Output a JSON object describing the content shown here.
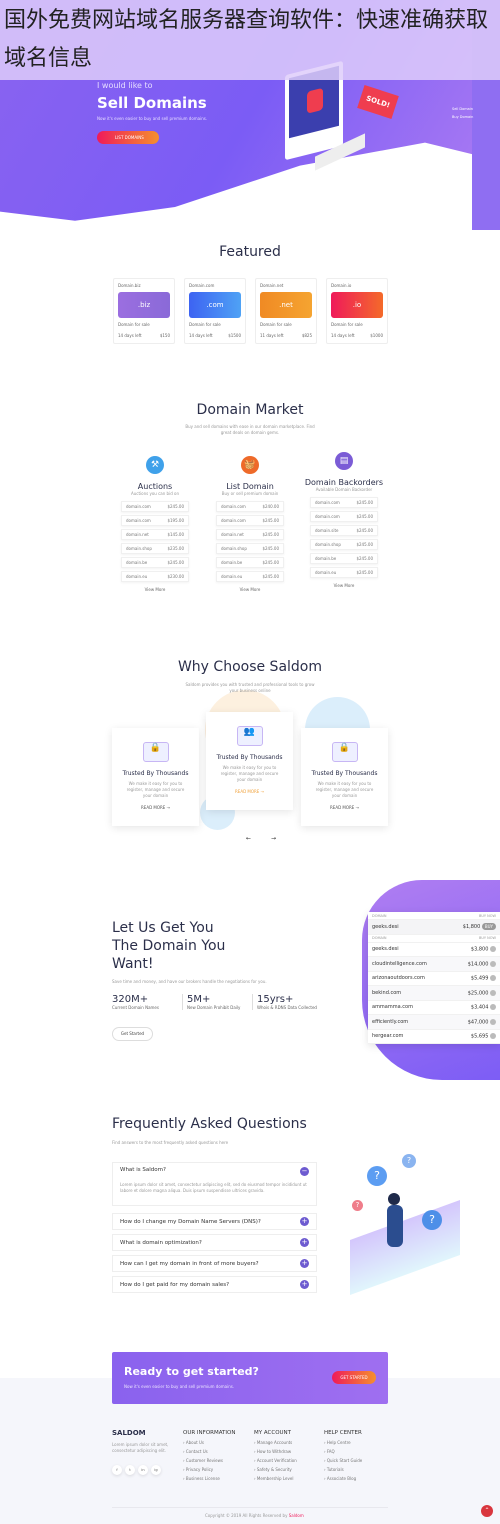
{
  "overlay_title": "国外免费网站域名服务器查询软件：快速准确获取域名信息",
  "hero": {
    "kicker": "I would like to",
    "title": "Sell Domains",
    "subtitle": "Now it's even easier to buy and sell premium domains.",
    "button": "LIST DOMAINS",
    "sign": "SOLD!",
    "toggle": [
      "Sell Domain",
      "Buy Domain"
    ]
  },
  "featured": {
    "title": "Featured",
    "cards": [
      {
        "name": "Domain.biz",
        "ext": ".biz",
        "status": "Domain for sale",
        "left": "14 days left",
        "price": "$150",
        "color1": "#9b6ee0",
        "color2": "#8a6ad8"
      },
      {
        "name": "Domain.com",
        "ext": ".com",
        "status": "Domain for sale",
        "left": "14 days left",
        "price": "$1500",
        "color1": "#3d63f2",
        "color2": "#4fa2f5"
      },
      {
        "name": "Domain.net",
        "ext": ".net",
        "status": "Domain for sale",
        "left": "11 days left",
        "price": "$825",
        "color1": "#f08a24",
        "color2": "#f5a431"
      },
      {
        "name": "Domain.io",
        "ext": ".io",
        "status": "Domain for sale",
        "left": "14 days left",
        "price": "$1000",
        "color1": "#ef1a5a",
        "color2": "#f46a2a"
      }
    ]
  },
  "market": {
    "title": "Domain Market",
    "subtitle": "Buy and sell domains with ease in our domain marketplace. Find great deals on domain gems.",
    "columns": [
      {
        "title": "Auctions",
        "subtitle": "Auctions you can bid on",
        "icon": "gavel-icon",
        "color": "#3fa1ea",
        "rows": [
          [
            "domain.com",
            "$245.00"
          ],
          [
            "domain.com",
            "$195.00"
          ],
          [
            "domain.net",
            "$145.00"
          ],
          [
            "domain.shop",
            "$235.00"
          ],
          [
            "domain.be",
            "$245.00"
          ],
          [
            "domain.eu",
            "$230.00"
          ]
        ],
        "more": "View More"
      },
      {
        "title": "List Domain",
        "subtitle": "Buy or sell premium domain",
        "icon": "basket-icon",
        "color": "#ee6a2a",
        "rows": [
          [
            "domain.com",
            "$240.00"
          ],
          [
            "domain.com",
            "$245.00"
          ],
          [
            "domain.net",
            "$245.00"
          ],
          [
            "domain.shop",
            "$245.00"
          ],
          [
            "domain.be",
            "$245.00"
          ],
          [
            "domain.eu",
            "$245.00"
          ]
        ],
        "more": "View More"
      },
      {
        "title": "Domain Backorders",
        "subtitle": "Available Domain Backorder",
        "icon": "document-icon",
        "color": "#7b5cd6",
        "rows": [
          [
            "domain.com",
            "$245.00"
          ],
          [
            "domain.com",
            "$245.00"
          ],
          [
            "domain.site",
            "$245.00"
          ],
          [
            "domain.shop",
            "$245.00"
          ],
          [
            "domain.be",
            "$245.00"
          ],
          [
            "domain.eu",
            "$245.00"
          ]
        ],
        "more": "View More"
      }
    ]
  },
  "why": {
    "title": "Why Choose Saldom",
    "subtitle": "Saldom provides you with trusted and professional tools to grow your business online",
    "cards": [
      {
        "title": "Trusted By Thousands",
        "text": "We make it easy for you to register, manage and secure your domain",
        "link": "READ MORE"
      },
      {
        "title": "Trusted By Thousands",
        "text": "We make it easy for you to register, manage and secure your domain",
        "link": "READ MORE"
      },
      {
        "title": "Trusted By Thousands",
        "text": "We make it easy for you to register, manage and secure your domain",
        "link": "READ MORE"
      }
    ],
    "prev": "←",
    "next": "→"
  },
  "getyou": {
    "title_lines": [
      "Let Us Get You",
      "The Domain You",
      "Want!"
    ],
    "desc": "Save time and money, and have our brokers handle the negotiations for you.",
    "stats": [
      {
        "value": "320M+",
        "label": "Current Domain Names"
      },
      {
        "value": "5M+",
        "label": "New Domain Prohibit Daily"
      },
      {
        "value": "15yrs+",
        "label": "Whois & RDNS Data Collected"
      }
    ],
    "button": "Get Started",
    "table": {
      "col1": "DOMAIN",
      "col2": "BUY NOW",
      "top": {
        "domain": "geeks.desi",
        "price": "$1,800",
        "btn": "BUY"
      },
      "rows": [
        [
          "geeks.desi",
          "$3,800"
        ],
        [
          "cloudintelligence.com",
          "$14,000"
        ],
        [
          "arizonaoutdoors.com",
          "$5,499"
        ],
        [
          "bekind.com",
          "$25,000"
        ],
        [
          "ammamma.com",
          "$3,404"
        ],
        [
          "efficiently.com",
          "$47,000"
        ],
        [
          "hergear.com",
          "$5,695"
        ]
      ]
    }
  },
  "faq": {
    "title": "Frequently Asked Questions",
    "subtitle": "Find answers to the most frequently asked questions here",
    "items": [
      {
        "q": "What is Saldom?",
        "a": "Lorem ipsum dolor sit amet, consectetur adipiscing elit, sed do eiusmod tempor incididunt ut labore et dolore magna aliqua. Duis ipsum suspendisse ultrices gravida.",
        "open": true
      },
      {
        "q": "How do I change my Domain Name Servers (DNS)?",
        "open": false
      },
      {
        "q": "What is domain optimization?",
        "open": false
      },
      {
        "q": "How can I get my domain in front of more buyers?",
        "open": false
      },
      {
        "q": "How do I get paid for my domain sales?",
        "open": false
      }
    ]
  },
  "cta": {
    "title": "Ready to get started?",
    "subtitle": "Now it's even easier to buy and sell premium domains.",
    "button": "GET STARTED"
  },
  "footer": {
    "brand": "SALDOM",
    "about": "Lorem ipsum dolor sit amet, consectetur adipiscing elit.",
    "social": [
      "f",
      "t",
      "in",
      "ig"
    ],
    "columns": [
      {
        "title": "OUR INFORMATION",
        "links": [
          "About Us",
          "Contact Us",
          "Customer Reviews",
          "Privacy Policy",
          "Business License"
        ]
      },
      {
        "title": "MY ACCOUNT",
        "links": [
          "Manage Accounts",
          "How to Withdraw",
          "Account Verification",
          "Safety & Security",
          "Membership Level"
        ]
      },
      {
        "title": "HELP CENTER",
        "links": [
          "Help Centre",
          "FAQ",
          "Quick Start Guide",
          "Tutorials",
          "Associate Blog"
        ]
      }
    ],
    "copyright": "Copyright © 2019 All Rights Reserved by",
    "copyright_brand": "Saldom"
  },
  "colors": {
    "primary": "#7b5cf5",
    "accent": "#ef1a5a",
    "dark": "#2b2f4a"
  }
}
